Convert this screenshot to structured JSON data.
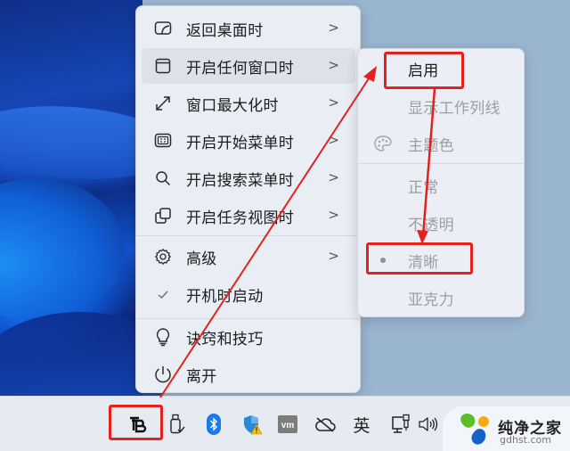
{
  "main_menu": {
    "items": [
      {
        "label": "返回桌面时",
        "icon": "desktop-icon",
        "has_submenu": true
      },
      {
        "label": "开启任何窗口时",
        "icon": "window-icon",
        "has_submenu": true,
        "highlighted": true
      },
      {
        "label": "窗口最大化时",
        "icon": "maximize-icon",
        "has_submenu": true
      },
      {
        "label": "开启开始菜单时",
        "icon": "start-menu-icon",
        "has_submenu": true
      },
      {
        "label": "开启搜索菜单时",
        "icon": "search-icon",
        "has_submenu": true
      },
      {
        "label": "开启任务视图时",
        "icon": "task-view-icon",
        "has_submenu": true
      },
      {
        "label": "高级",
        "icon": "gear-icon",
        "has_submenu": true
      },
      {
        "label": "开机时启动",
        "icon": "checkmark-icon",
        "checked": true
      },
      {
        "label": "诀窍和技巧",
        "icon": "lightbulb-icon"
      },
      {
        "label": "离开",
        "icon": "power-icon"
      }
    ],
    "chevron": ">"
  },
  "submenu": {
    "items": [
      {
        "label": "启用",
        "enabled": true
      },
      {
        "label": "显示工作列线",
        "enabled": false
      },
      {
        "label": "主题色",
        "enabled": false,
        "icon": "palette-icon"
      },
      {
        "label": "正常",
        "enabled": false
      },
      {
        "label": "不透明",
        "enabled": false
      },
      {
        "label": "清晰",
        "enabled": false,
        "selected": true
      },
      {
        "label": "亚克力",
        "enabled": false
      }
    ]
  },
  "taskbar": {
    "tray_icons": [
      {
        "name": "translucenttb-icon",
        "label": "TB"
      },
      {
        "name": "usb-drive-icon"
      },
      {
        "name": "bluetooth-icon"
      },
      {
        "name": "windows-security-warning-icon"
      },
      {
        "name": "vmware-icon",
        "label": "vm"
      },
      {
        "name": "onedrive-offline-icon"
      },
      {
        "name": "input-language-icon",
        "label": "英"
      },
      {
        "name": "network-icon"
      },
      {
        "name": "volume-icon"
      }
    ]
  },
  "watermark": {
    "title": "纯净之家",
    "url": "gdhst.com"
  },
  "annotations": {
    "color": "#e4211c"
  }
}
